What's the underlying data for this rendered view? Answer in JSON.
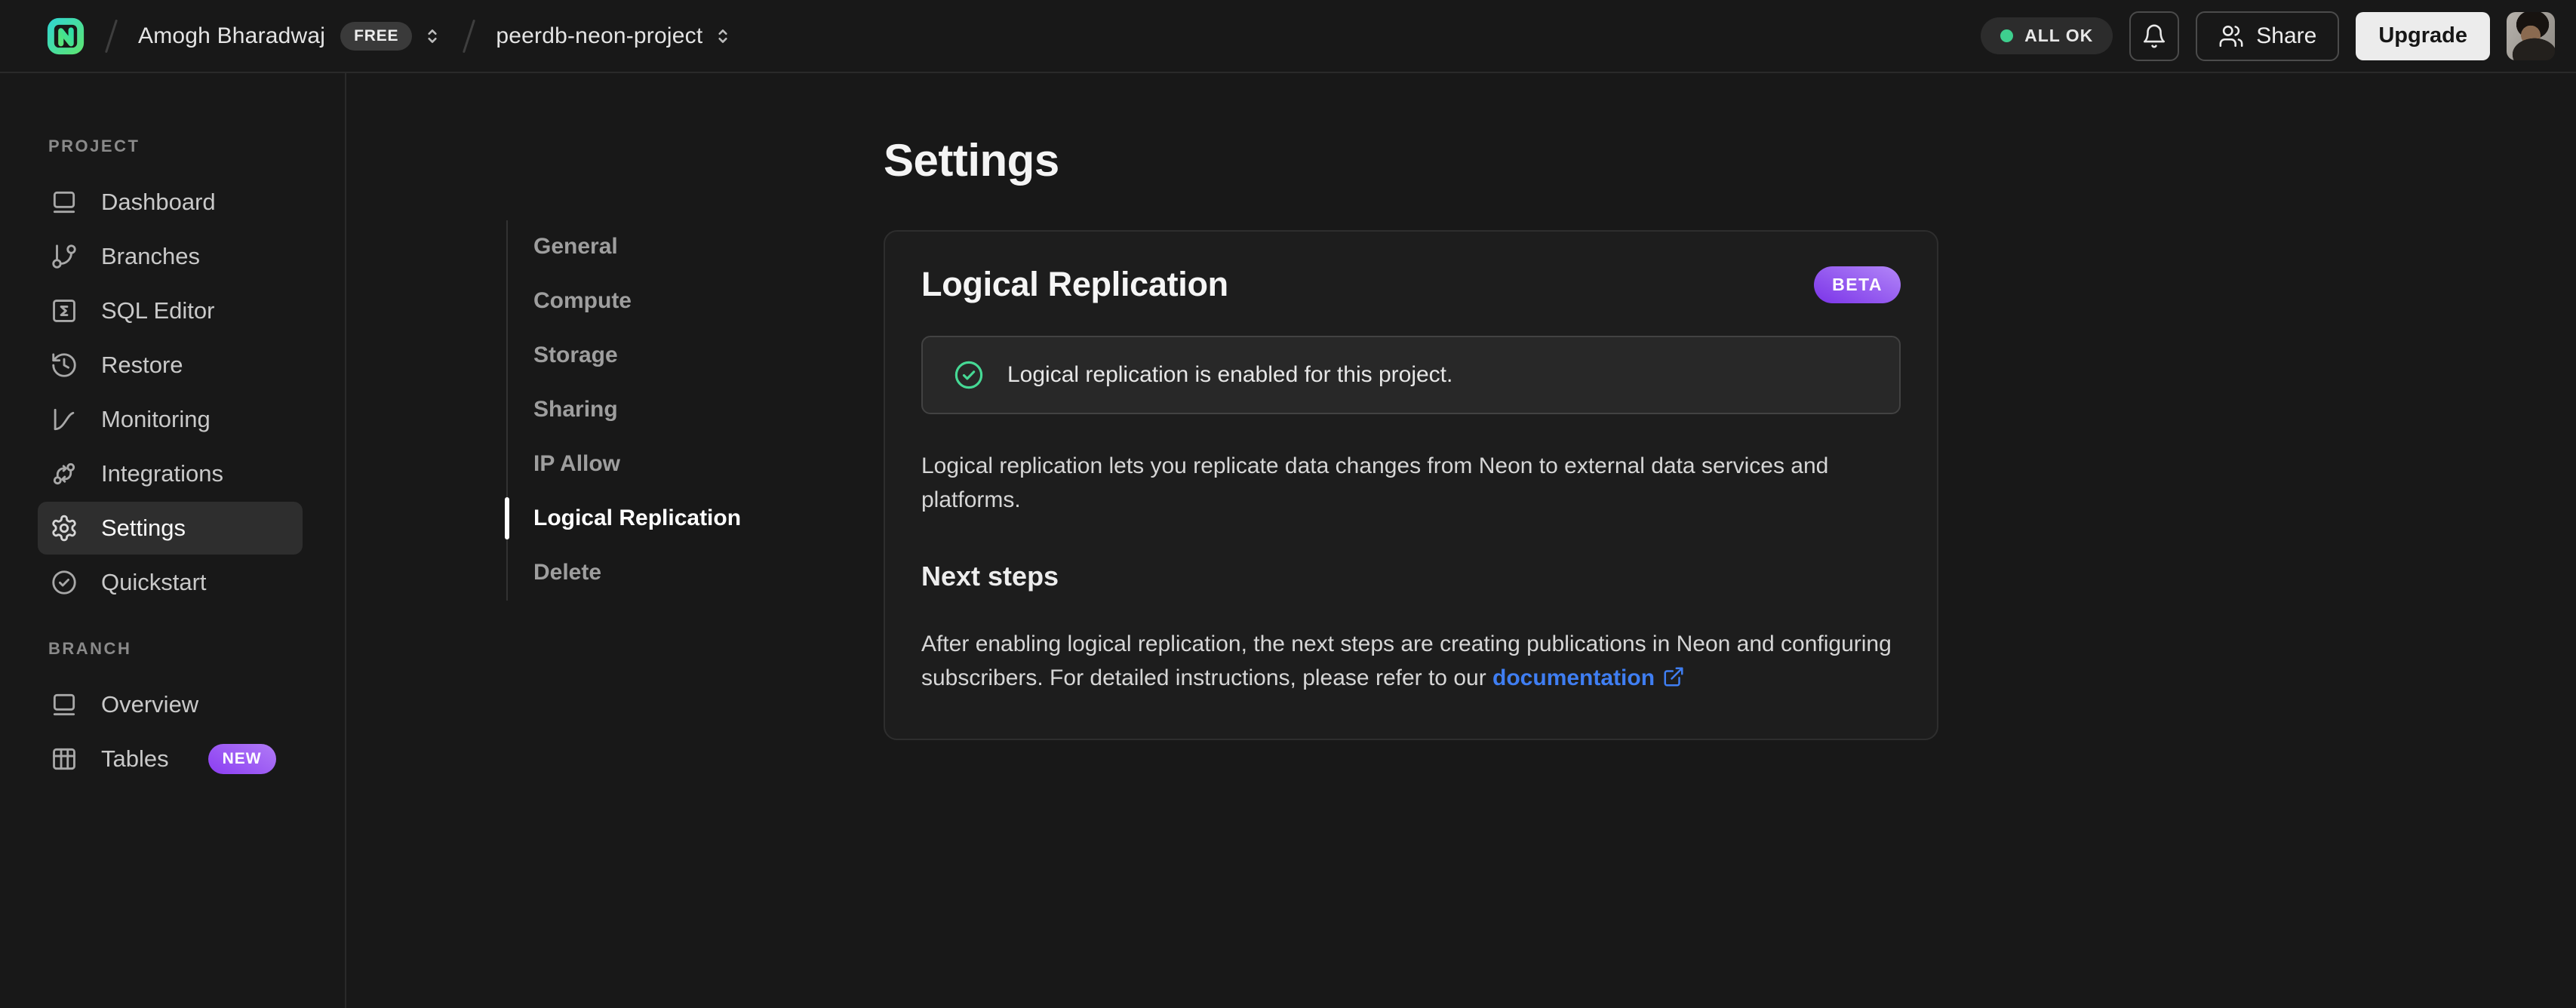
{
  "header": {
    "breadcrumb": {
      "org": "Amogh Bharadwaj",
      "org_badge": "FREE",
      "project": "peerdb-neon-project"
    },
    "status_badge": "ALL OK",
    "share_button": "Share",
    "upgrade_button": "Upgrade"
  },
  "sidebar": {
    "sections": [
      {
        "label": "PROJECT",
        "items": [
          {
            "label": "Dashboard",
            "icon": "dashboard-icon",
            "active": false
          },
          {
            "label": "Branches",
            "icon": "branches-icon",
            "active": false
          },
          {
            "label": "SQL Editor",
            "icon": "sql-editor-icon",
            "active": false
          },
          {
            "label": "Restore",
            "icon": "restore-icon",
            "active": false
          },
          {
            "label": "Monitoring",
            "icon": "monitoring-icon",
            "active": false
          },
          {
            "label": "Integrations",
            "icon": "integrations-icon",
            "active": false
          },
          {
            "label": "Settings",
            "icon": "settings-gear-icon",
            "active": true
          },
          {
            "label": "Quickstart",
            "icon": "quickstart-icon",
            "active": false
          }
        ]
      },
      {
        "label": "BRANCH",
        "items": [
          {
            "label": "Overview",
            "icon": "overview-icon",
            "active": false
          },
          {
            "label": "Tables",
            "icon": "tables-icon",
            "badge": "NEW",
            "active": false
          }
        ]
      }
    ]
  },
  "settings_nav": {
    "items": [
      {
        "label": "General",
        "active": false
      },
      {
        "label": "Compute",
        "active": false
      },
      {
        "label": "Storage",
        "active": false
      },
      {
        "label": "Sharing",
        "active": false
      },
      {
        "label": "IP Allow",
        "active": false
      },
      {
        "label": "Logical Replication",
        "active": true
      },
      {
        "label": "Delete",
        "active": false
      }
    ]
  },
  "main": {
    "page_title": "Settings",
    "card": {
      "title": "Logical Replication",
      "beta_badge": "BETA",
      "success_message": "Logical replication is enabled for this project.",
      "description": "Logical replication lets you replicate data changes from Neon to external data services and platforms.",
      "next_steps": {
        "title": "Next steps",
        "text_before_link": "After enabling logical replication, the next steps are creating publications in Neon and configuring subscribers. For detailed instructions, please refer to our ",
        "link_label": "documentation"
      }
    }
  },
  "colors": {
    "page_background": "#181818",
    "card_background": "#1d1d1d",
    "banner_background": "#282828",
    "accent_green": "#3ecf8e",
    "success_green": "#46d995",
    "link_blue": "#3f7ef2",
    "badge_purple_start": "#b286f8",
    "badge_purple_end": "#7b34e8"
  }
}
